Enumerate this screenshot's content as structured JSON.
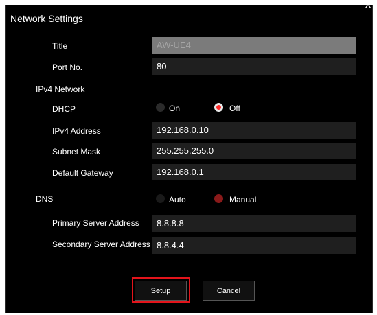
{
  "dialog": {
    "title": "Network Settings",
    "close_symbol": "X"
  },
  "fields": {
    "title_label": "Title",
    "title_value": "AW-UE4",
    "port_label": "Port No.",
    "port_value": "80"
  },
  "ipv4": {
    "section_label": "IPv4 Network",
    "dhcp_label": "DHCP",
    "dhcp_on": "On",
    "dhcp_off": "Off",
    "dhcp_selected": "Off",
    "address_label": "IPv4 Address",
    "address_value": "192.168.0.10",
    "subnet_label": "Subnet Mask",
    "subnet_value": "255.255.255.0",
    "gateway_label": "Default Gateway",
    "gateway_value": "192.168.0.1"
  },
  "dns": {
    "section_label": "DNS",
    "auto": "Auto",
    "manual": "Manual",
    "selected": "Manual",
    "primary_label": "Primary Server Address",
    "primary_value": "8.8.8.8",
    "secondary_label": "Secondary Server Address",
    "secondary_value": "8.8.4.4"
  },
  "buttons": {
    "setup": "Setup",
    "cancel": "Cancel"
  },
  "colors": {
    "background": "#000000",
    "accent": "#e3141b",
    "field": "#1f1f1f"
  }
}
